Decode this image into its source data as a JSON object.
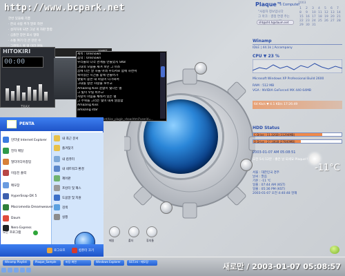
{
  "header": {
    "url": "http://www.bcpark.net"
  },
  "memo": {
    "lines": [
      "한번 있을때 기쁨",
      "· 한국 사람 추가 말로 하면",
      "· 설치하게 되면 그냥 게 자판 말합",
      "· 심플한 장면 표시 형태",
      "· 소통 여기 더 큰 잔잔 수",
      "· 그래픽스 볼 없 미라 원들"
    ]
  },
  "player": {
    "title": "HITOKIRI",
    "time": "00:00",
    "tag": "TRAX",
    "brand": "XNET"
  },
  "chat": {
    "lines": [
      "제목 : Unknown",
      "음악 : Unknown",
      "",
      "우리들의 다각 관계를 만들었지 SKB",
      "그대의 모습을 새겨 보던 그 미소",
      "꿈에 나는 말 하늘 아래 우리서로 함께 하면서",
      "숙이었던 시간을 함께 만들어가",
      "별빛이 쏟은 내 마음이 다가와서",
      "그대를 향한 사랑을 보주고",
      "",
      "Amazing Kiss 끝없이 빛나는 별",
      "그 빛이 우릴 비추고",
      "사랑이 마음을 채워서 있는 별",
      "그 주위를 그리는 빛이 내게 달콤함",
      "Amazing Kiss",
      "amazing star"
    ],
    "status": "http://www.rokmc.net/kiss_plugin_show.html?userid=..."
  },
  "start_menu": {
    "user_name": "PENTA",
    "left_items": [
      "인터넷 Internet Explorer",
      "전자 메일",
      "멀티미디어창업",
      "이동진 출력",
      "메모장",
      "HyperSnap-DX 5",
      "Macromedia Dreamweaver MX",
      "Daum",
      "Nero Express"
    ],
    "right_items": [
      "내 최근 문서",
      "즐겨찾기",
      "내 컴퓨터",
      "내 네트워크 환경",
      "제어판",
      "프린터 및 팩스",
      "도움말 및 지원",
      "검색",
      "실행"
    ],
    "all_programs": "모든 프로그램",
    "logoff_label": "로그오프",
    "shutdown_label": "컴퓨터 끄기"
  },
  "desktop_icons": [
    {
      "name": "icon-a",
      "label": "메일"
    },
    {
      "name": "icon-b",
      "label": "폴더"
    },
    {
      "name": "icon-c",
      "label": "휴지통"
    }
  ],
  "right_panel": {
    "plaque_title": "Plaque™",
    "plaque_sub": "'s Computer",
    "plaque_lines": [
      "\"사용자 정보입니다",
      "그 마크 : 결정 연결 주는",
      "Windows 시스템"
    ],
    "plaque_email": "sht@sht.h@daum.net",
    "winamp": "Winamp",
    "winamp_line": "IDLE  |  44.1k  |  Accompany",
    "cpu": "CPU ▼ 23 %",
    "os": "Microsoft Windows XP Professional    Build 2600",
    "ram": "RAM : 512 MB",
    "gpu": "VGA : NVIDIA GeForce4 MX 440   64MB",
    "net": "64 Kb/s ▼ 4.1 KB/s  17:26:49",
    "hdd_title": "HDD Status",
    "hdd": [
      {
        "label": "C Drive : 11.32GB  (11294MB)",
        "fill": 0.78
      },
      {
        "label": "D Drive : 27.18GB  (27840MB)",
        "fill": 0.54
      }
    ],
    "date1": "2003-01-07 AM 05:08:51",
    "date2": "오전 5시 12분 : 좋은 날 되세요 Plaque!!",
    "weather": [
      "서울 : 대한민국 경주",
      "날씨 : 맑음",
      "기온 : -11 ℃",
      "일출 : 07:44 AM (KST)",
      "일몰 : 05:36 PM (KST)",
      "2003-01-07 오전 4:40:48 현재"
    ],
    "temp": "-11°C",
    "calendar_title": "2003",
    "calendar_days": [
      "1",
      "2",
      "3",
      "4",
      "5",
      "6",
      "7",
      "8",
      "9",
      "10",
      "11",
      "12",
      "13",
      "14",
      "15",
      "16",
      "17",
      "18",
      "19",
      "20",
      "21",
      "22",
      "23",
      "24",
      "25",
      "26",
      "27",
      "28",
      "29",
      "30",
      "31"
    ]
  },
  "taskbar": {
    "items": [
      "Winamp Playlist",
      "Plaque_Sample",
      "바탕 화면",
      "Windows Explorer",
      "SST.ini - 메모장"
    ],
    "clock": "새로만 / 2003-01-07 05:08:57"
  }
}
